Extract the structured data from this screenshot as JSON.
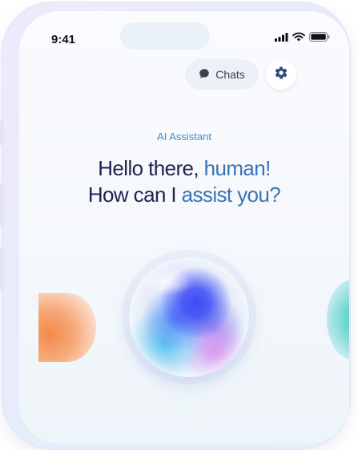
{
  "status_bar": {
    "time": "9:41",
    "icons": [
      "signal-icon",
      "wifi-icon",
      "battery-icon"
    ]
  },
  "header": {
    "chats_label": "Chats",
    "chats_icon": "chat-bubble-icon",
    "settings_icon": "gear-icon"
  },
  "main": {
    "label": "AI Assistant",
    "greeting_line1_a": "Hello there, ",
    "greeting_line1_b": "human!",
    "greeting_line2_a": "How can I ",
    "greeting_line2_b": "assist you?"
  },
  "colors": {
    "accent": "#3a74b4",
    "label": "#3e8fd0",
    "headline": "#1f2350",
    "orb_primary": "#3d4bf5",
    "orb_left": "#f48a4a",
    "orb_right": "#36c2c9"
  }
}
